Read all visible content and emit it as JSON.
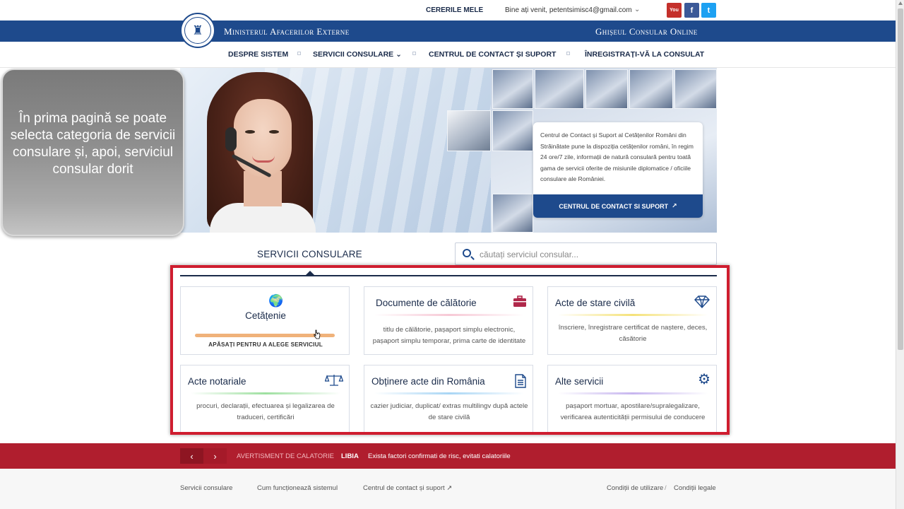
{
  "topbar": {
    "requests_label": "CERERILE MELE",
    "welcome_text": "Bine ați venit,",
    "user_email": "petentsimisc4@gmail.com",
    "social": [
      {
        "name": "youtube",
        "glyph": "You",
        "color": "#c4302b"
      },
      {
        "name": "facebook",
        "glyph": "f",
        "color": "#3b5998"
      },
      {
        "name": "twitter",
        "glyph": "t",
        "color": "#1da1f2"
      }
    ]
  },
  "header": {
    "ministry_title": "Ministerul Afacerilor Externe",
    "portal_title": "Ghișeul Consular Online",
    "seal_glyph": "♜",
    "brand_color": "#1e4a8c"
  },
  "nav": {
    "items": [
      {
        "label": "DESPRE SISTEM"
      },
      {
        "label": "SERVICII CONSULARE ⌄"
      },
      {
        "label": "CENTRUL DE CONTACT ȘI SUPORT"
      },
      {
        "label": "ÎNREGISTRAȚI-VĂ LA CONSULAT"
      }
    ]
  },
  "hero": {
    "info_text": "Centrul de Contact și Suport al Cetățenilor Români din Străinătate pune la dispoziția cetățenilor români, în regim 24 ore/7 zile, informații de natură consulară pentru toată gama de servicii oferite de misiunile diplomatice / oficiile consulare ale României.",
    "info_button": "CENTRUL DE CONTACT SI SUPORT",
    "info_button_icon": "external-link"
  },
  "callout": {
    "text": "În prima pagină se poate selecta categoria de servicii consulare și, apoi,  serviciul consular dorit"
  },
  "services": {
    "title": "SERVICII CONSULARE",
    "search_placeholder": "căutați serviciul consular...",
    "cards": [
      {
        "title": "Cetățenie",
        "icon": "globe-icon",
        "glyph": "🌍",
        "cta": "APĂSAȚI PENTRU A ALEGE SERVICIUL",
        "accent": "#f0b27a"
      },
      {
        "title": "Documente de călătorie",
        "icon": "briefcase-icon",
        "glyph": "💼",
        "desc": "titlu de călătorie, pașaport simplu electronic, pașaport simplu temporar, prima carte de identitate",
        "accent": "#f7c9d6"
      },
      {
        "title": "Acte de stare civilă",
        "icon": "diamond-icon",
        "glyph": "◇",
        "desc": "înscriere, înregistrare certificat de naștere, deces, căsătorie",
        "accent": "#f5e27a"
      },
      {
        "title": "Acte notariale",
        "icon": "scale-icon",
        "glyph": "⚖",
        "desc": "procuri, declarații, efectuarea și legalizarea de traduceri, certificări",
        "accent": "#9ee0a0"
      },
      {
        "title": "Obținere acte din România",
        "icon": "document-icon",
        "glyph": "🗎",
        "desc": "cazier judiciar, duplicat/ extras multilingv după actele de stare civilă",
        "accent": "#a9d6f5"
      },
      {
        "title": "Alte servicii",
        "icon": "gears-icon",
        "glyph": "⚙",
        "desc": "pașaport mortuar, apostilare/supralegalizare, verificarea autenticității permisului de conducere",
        "accent": "#c7b6ef"
      }
    ]
  },
  "warning": {
    "prev_glyph": "‹",
    "next_glyph": "›",
    "label": "AVERTISMENT DE CALATORIE",
    "country": "LIBIA",
    "message": "Exista factori confirmati de risc, evitati calatoriile",
    "color": "#b01e2e"
  },
  "footer": {
    "links": [
      {
        "label": "Servicii consulare"
      },
      {
        "label": "Cum funcționează sistemul"
      },
      {
        "label": "Centrul de contact și suport"
      }
    ],
    "right_links": [
      {
        "label": "Condiții de utilizare"
      },
      {
        "label": "Condiții legale"
      }
    ]
  },
  "annotation": {
    "frame_color": "#cf1d2f"
  }
}
